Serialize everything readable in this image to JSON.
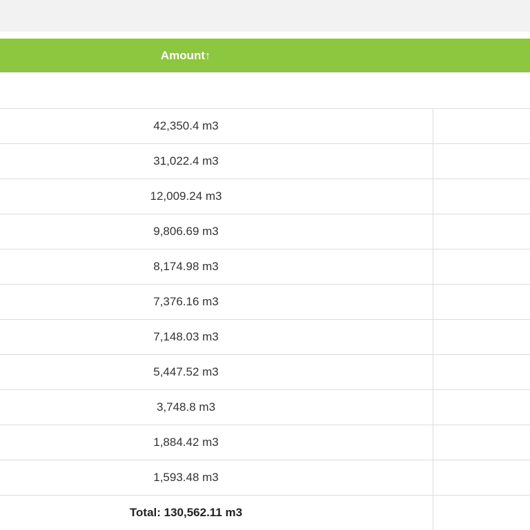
{
  "header": {
    "amount_label": "Amount",
    "sort_indicator": "↑",
    "accent_color": "#8dc63f"
  },
  "rows": [
    {
      "amount": "42,350.4 m3"
    },
    {
      "amount": "31,022.4 m3"
    },
    {
      "amount": "12,009.24 m3"
    },
    {
      "amount": "9,806.69 m3"
    },
    {
      "amount": "8,174.98 m3"
    },
    {
      "amount": "7,376.16 m3"
    },
    {
      "amount": "7,148.03 m3"
    },
    {
      "amount": "5,447.52 m3"
    },
    {
      "amount": "3,748.8 m3"
    },
    {
      "amount": "1,884.42 m3"
    },
    {
      "amount": "1,593.48 m3"
    }
  ],
  "total": {
    "label": "Total: 130,562.11 m3"
  }
}
